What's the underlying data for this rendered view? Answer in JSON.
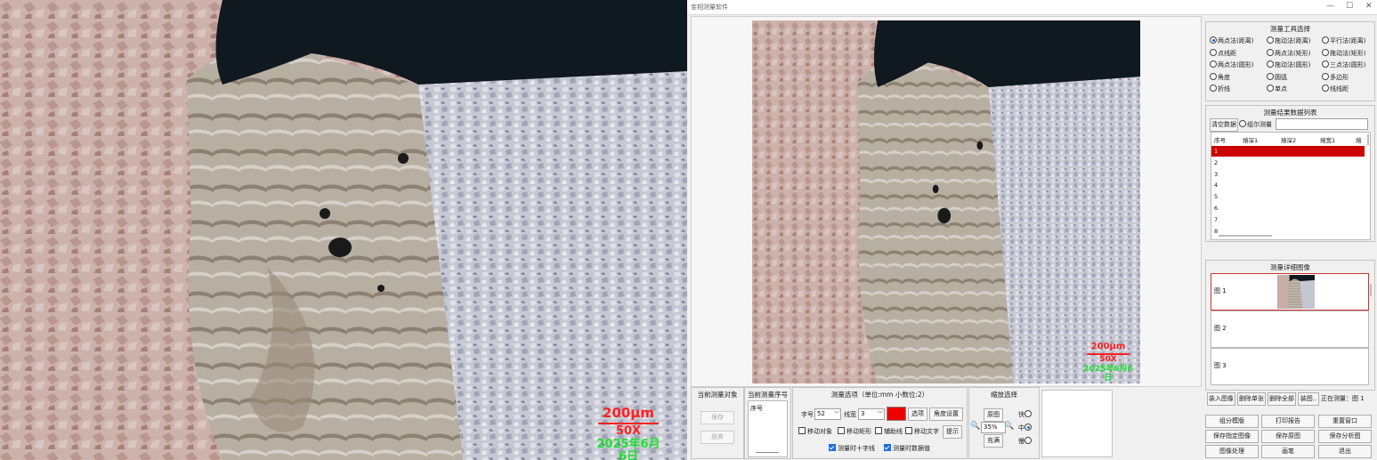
{
  "photo": {
    "scale_label": "200μm",
    "magnification": "50X",
    "date": "2025年6月6日"
  },
  "window": {
    "title": "金相测量软件",
    "controls": [
      "—",
      "☐",
      "✕"
    ]
  },
  "tools_panel": {
    "title": "测量工具选择",
    "options": [
      {
        "label": "两点法(距离)",
        "selected": true
      },
      {
        "label": "拖动法(距离)",
        "selected": false
      },
      {
        "label": "平行法(距离)",
        "selected": false
      },
      {
        "label": "点线距",
        "selected": false
      },
      {
        "label": "两点法(矩形)",
        "selected": false
      },
      {
        "label": "拖动法(矩形)",
        "selected": false
      },
      {
        "label": "两点法(圆形)",
        "selected": false
      },
      {
        "label": "拖动法(圆形)",
        "selected": false
      },
      {
        "label": "三点法(圆形)",
        "selected": false
      },
      {
        "label": "角度",
        "selected": false
      },
      {
        "label": "圆弧",
        "selected": false
      },
      {
        "label": "多边形",
        "selected": false
      },
      {
        "label": "折线",
        "selected": false
      },
      {
        "label": "单点",
        "selected": false
      },
      {
        "label": "线线距",
        "selected": false
      }
    ]
  },
  "results_panel": {
    "title": "测量结果数据列表",
    "clear_label": "清空数据",
    "continuous_label": "组尔测量",
    "columns": [
      "序号",
      "熔深1",
      "熔深2",
      "熔宽1",
      "熔宽"
    ],
    "rows": [
      "1",
      "2",
      "3",
      "4",
      "5",
      "6",
      "7",
      "8"
    ],
    "selected_row": "1"
  },
  "thumbs_panel": {
    "title": "测量详细图像",
    "items": [
      "图 1",
      "图 2",
      "图 3"
    ]
  },
  "thumb_buttons": [
    "装入图像",
    "删除单张",
    "删除全部",
    "装图..",
    "正在测量：图 1"
  ],
  "bottom_buttons": [
    [
      "组分模版",
      "打印报告",
      "重置窗口"
    ],
    [
      "保存指定图像",
      "保存原图",
      "保存分析图"
    ],
    [
      "图像处理",
      "画笔",
      "退出"
    ]
  ],
  "current_object": {
    "title": "当前测量对象",
    "save_label": "保存",
    "redo_label": "放弃"
  },
  "current_seq": {
    "title": "当前测量序号",
    "seq_label": "序号"
  },
  "options_panel": {
    "title": "测量选项（单位:mm  小数位:2）",
    "font_label": "字号",
    "font_value": "52",
    "line_label": "线宽",
    "line_value": "3",
    "color": "#ee0000",
    "color_btn": "选项",
    "angle_btn": "角度设置",
    "chk_select": "移动对象",
    "chk_move": "移动矩形",
    "chk_aux": "辅助线",
    "chk_text": "移动文字",
    "hint_btn": "提示",
    "chk_cross": "测量时十字线",
    "chk_value": "测量时数据值"
  },
  "zoom_panel": {
    "title": "缩放选择",
    "original_btn": "原图",
    "zoom_value": "35%",
    "fill_btn": "充满",
    "speed_fast": "快",
    "speed_mid": "中",
    "speed_slow": "慢"
  }
}
